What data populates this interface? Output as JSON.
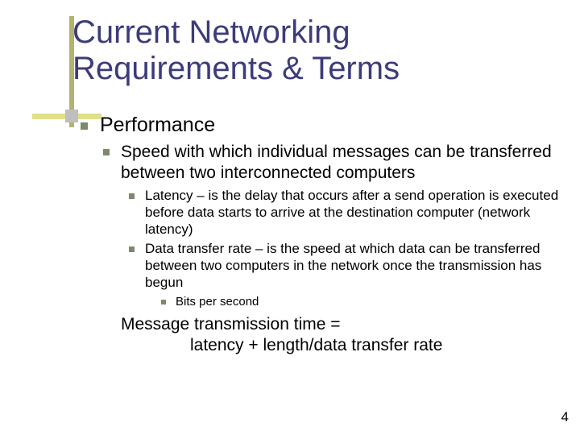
{
  "title": "Current Networking Requirements & Terms",
  "pageNumber": "4",
  "body": {
    "level1": "Performance",
    "level2_speed": "Speed with which individual messages can be transferred between two interconnected computers",
    "level3_latency": "Latency – is the delay that occurs after a send operation is executed before data starts to arrive at the destination computer (network latency)",
    "level3_rate": "Data transfer rate – is the speed at which data can be transferred between two computers in the network once the transmission has begun",
    "level4_bps": "Bits per second",
    "level2_eq_line1": "Message transmission time =",
    "level2_eq_line2": "latency + length/data transfer rate"
  }
}
